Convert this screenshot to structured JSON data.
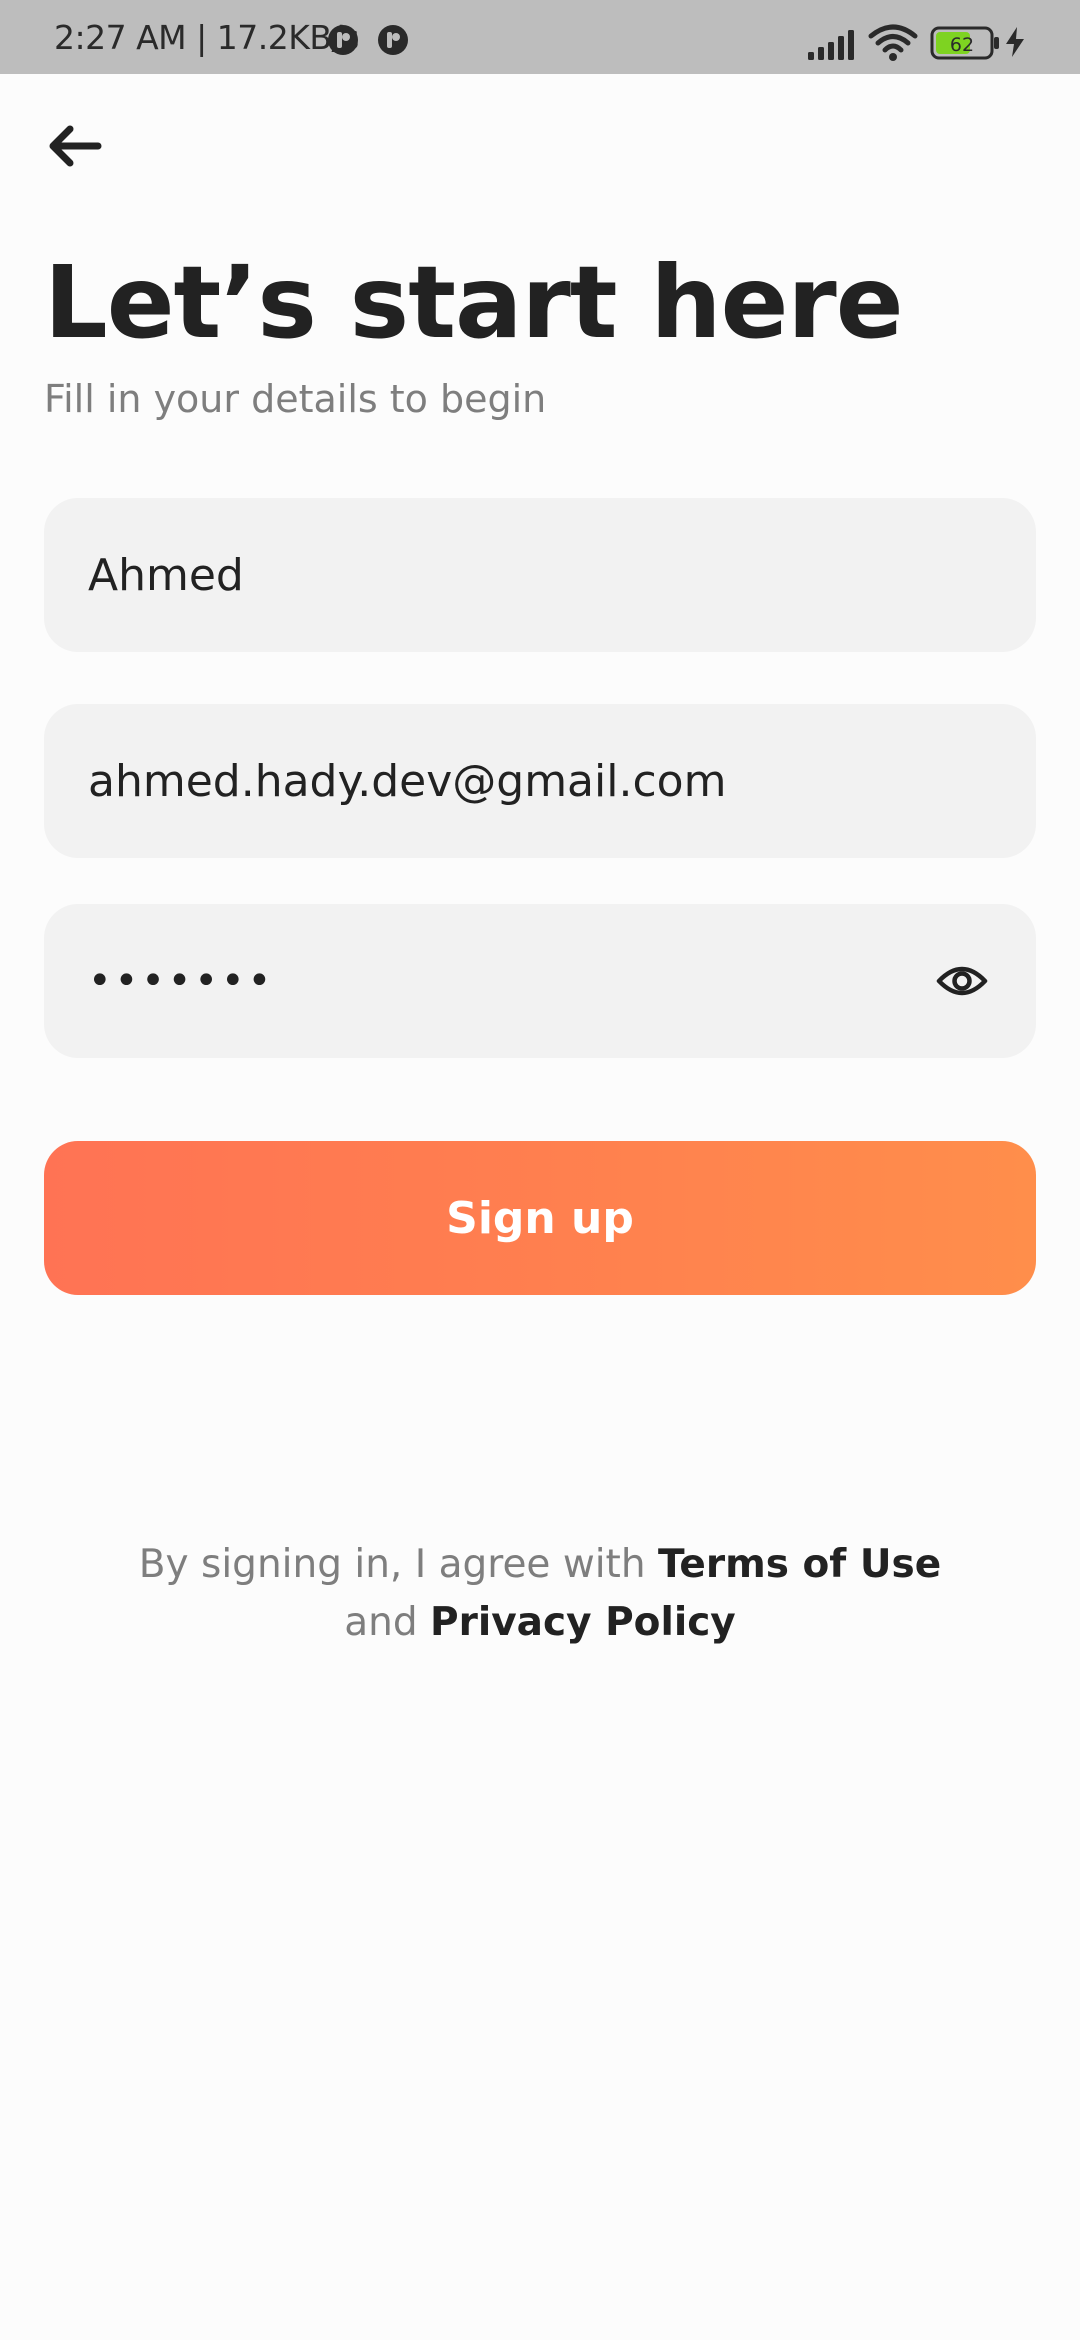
{
  "status_bar": {
    "time": "2:27 AM | 17.2KB/s",
    "battery_level": "62",
    "icons": [
      "app-badge-icon",
      "app-badge-icon",
      "signal-icon",
      "wifi-icon",
      "battery-icon",
      "charging-icon"
    ],
    "battery_color": "#7ED321"
  },
  "header": {
    "back_icon": "back-arrow-icon"
  },
  "content": {
    "title": "Let’s start here",
    "subtitle": "Fill in your details to begin"
  },
  "form": {
    "name_value": "Ahmed",
    "email_value": "ahmed.hady.dev@gmail.com",
    "password_masked": "•••••••",
    "password_toggle_icon": "eye-icon",
    "signup_label": "Sign up"
  },
  "legal": {
    "prefix": "By signing in, I agree with ",
    "terms_label": "Terms of Use",
    "conjunction": "and ",
    "privacy_label": "Privacy Policy"
  },
  "colors": {
    "background": "#FCFCFC",
    "status_bar": "#BDBDBD",
    "field_background": "#F2F2F2",
    "button_gradient_start": "#FF7354",
    "button_gradient_end": "#FF8E4B",
    "primary_text": "#222222",
    "secondary_text": "#7E7E7E"
  }
}
